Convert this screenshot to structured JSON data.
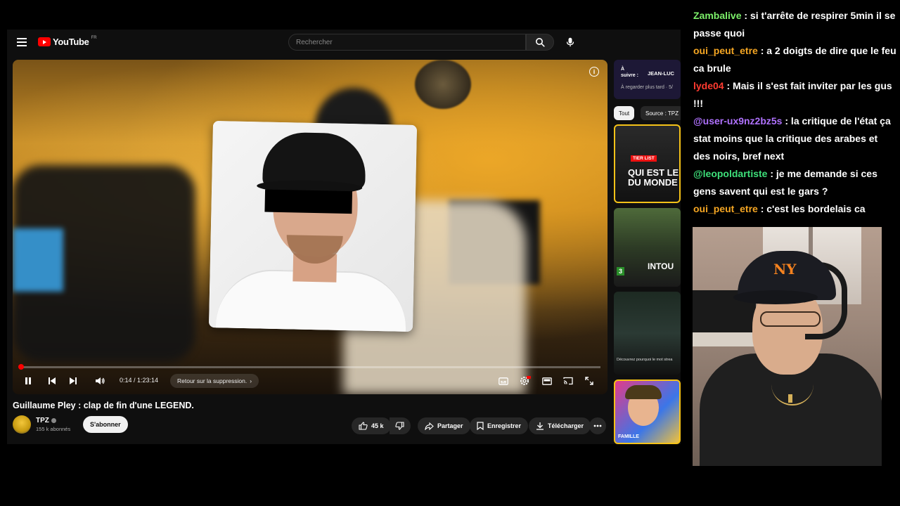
{
  "youtube": {
    "logo_text": "YouTube",
    "country_code": "FR",
    "search_placeholder": "Rechercher",
    "player": {
      "progress_percent": 0.2,
      "time": "0:14 / 1:23:14",
      "chapter": "Retour sur la suppression.",
      "chapter_chevron": "›"
    },
    "video": {
      "title": "Guillaume Pley : clap de fin d'une LEGEND.",
      "channel_name": "TPZ",
      "subscribers": "155 k abonnés",
      "subscribe_label": "S'abonner",
      "likes": "45 k",
      "share_label": "Partager",
      "save_label": "Enregistrer",
      "download_label": "Télécharger"
    },
    "sidebar": {
      "up_next_label": "À\nsuivre :",
      "up_next_title": "JEAN-LUC",
      "up_next_sub": "À regarder plus tard · 5/",
      "chips": [
        "Tout",
        "Source : TPZ"
      ],
      "rec1_badge": "TIER LIST",
      "rec1_title": "QUI EST LE ME\nDU MONDE",
      "rec2_title": "INTOU",
      "rec2_badge": "3",
      "rec3_caption": "Découvrez pourquoi le mot strea",
      "rec4_label": "FAMILLE"
    },
    "colors": {
      "accent": "#ff0000",
      "background": "#0f0f0f"
    }
  },
  "chat": {
    "messages": [
      {
        "user": "Zambalive",
        "color": "#7cf06a",
        "text": " : si t'arrête de respirer 5min il se passe quoi"
      },
      {
        "user": "oui_peut_etre",
        "color": "#f5a623",
        "text": " : a 2 doigts de dire que le feu ca brule"
      },
      {
        "user": "lyde04",
        "color": "#ff3b30",
        "text": " : Mais il s'est fait inviter par les gus !!!"
      },
      {
        "user": "@user-ux9nz2bz5s",
        "color": "#b072ff",
        "text": " : la critique de l'état ça stat moins que la critique des arabes et des noirs, bref next"
      },
      {
        "user": "@leopoldartiste",
        "color": "#3ee07a",
        "text": " : je me demande si ces gens savent qui est le gars ?"
      },
      {
        "user": "oui_peut_etre",
        "color": "#f5a623",
        "text": " : c'est les bordelais ca"
      }
    ]
  },
  "webcam": {
    "cap_logo": "NY"
  }
}
